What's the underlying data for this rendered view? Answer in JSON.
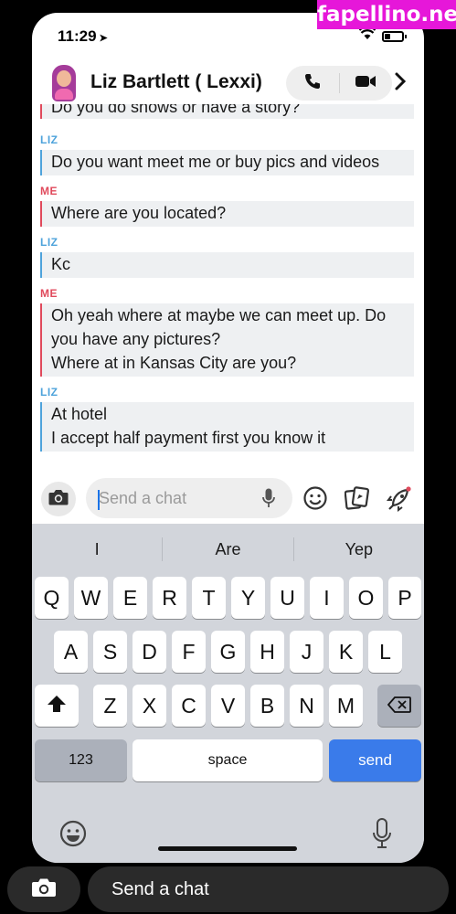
{
  "watermark": "fapellino.net",
  "status_bar": {
    "time": "11:29",
    "location_glyph": "➤"
  },
  "header": {
    "contact_name": "Liz Bartlett ( Lexxi)"
  },
  "messages": [
    {
      "sender": "",
      "text": "Do you do shows or have a story?"
    },
    {
      "sender": "LIZ",
      "text": "Do you want meet me or buy pics and videos"
    },
    {
      "sender": "ME",
      "text": "Where are you located?"
    },
    {
      "sender": "LIZ",
      "text": "Kc"
    },
    {
      "sender": "ME",
      "lines": [
        "Oh yeah where at maybe we can meet up.  Do",
        "you have any pictures?",
        "Where at in Kansas City are you?"
      ]
    },
    {
      "sender": "LIZ",
      "lines": [
        "At hotel",
        "I accept half payment  first  you know it"
      ]
    }
  ],
  "input_bar": {
    "placeholder": "Send a chat"
  },
  "keyboard": {
    "suggestions": [
      "I",
      "Are",
      "Yep"
    ],
    "row1": [
      "Q",
      "W",
      "E",
      "R",
      "T",
      "Y",
      "U",
      "I",
      "O",
      "P"
    ],
    "row2": [
      "A",
      "S",
      "D",
      "F",
      "G",
      "H",
      "J",
      "K",
      "L"
    ],
    "row3": [
      "Z",
      "X",
      "C",
      "V",
      "B",
      "N",
      "M"
    ],
    "numbers_key": "123",
    "space_key": "space",
    "send_key": "send"
  },
  "bottom_bar": {
    "chat_label": "Send a chat"
  },
  "colors": {
    "liz": "#4ea3db",
    "me": "#e04a5c",
    "send": "#3a7bea",
    "watermark": "#e617d9"
  },
  "icons": [
    "location-arrow-icon",
    "wifi-icon",
    "battery-icon",
    "avatar",
    "phone-icon",
    "video-icon",
    "chevron-right-icon",
    "camera-icon",
    "microphone-icon",
    "emoji-icon",
    "sticker-icon",
    "rocket-icon",
    "shift-icon",
    "backspace-icon",
    "keyboard-emoji-icon",
    "dictation-icon"
  ]
}
